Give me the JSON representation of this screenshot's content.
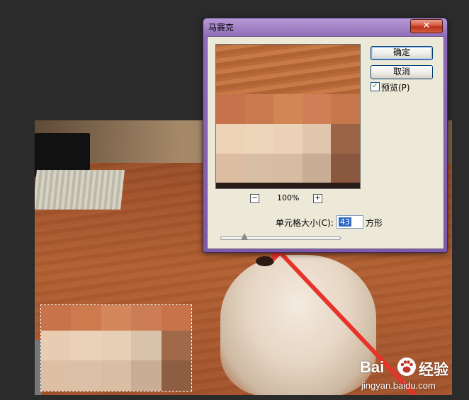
{
  "dialog": {
    "title": "马赛克",
    "close_label": "✕",
    "ok_label": "确定",
    "cancel_label": "取消",
    "preview_label": "预览(P)",
    "preview_checked": true,
    "zoom_out_label": "−",
    "zoom_in_label": "+",
    "zoom_value": "100%",
    "cell_size_label": "单元格大小(C):",
    "cell_size_value": "43",
    "cell_size_unit": "方形",
    "slider_fraction": 0.2
  },
  "watermark": {
    "brand": "Bai",
    "brand2": "经验",
    "url": "jingyan.baidu.com",
    "paw_icon": "baidu-paw-icon"
  },
  "colors": {
    "accent_purple": "#7d5aa8",
    "arrow_red": "#e8332a"
  },
  "mosaic_colors": [
    "#c9734a",
    "#cd7a4f",
    "#d4875a",
    "#cd7d55",
    "#c87349",
    "#e8cdb3",
    "#ead2b9",
    "#e7cfb5",
    "#d8c2aa",
    "#a06a4a",
    "#ddbfa4",
    "#dac1a7",
    "#d8bea3",
    "#c9ae96",
    "#8e5e42"
  ],
  "preview_colors": [
    "#c6724a",
    "#c97a4f",
    "#d28656",
    "#ce7f55",
    "#c6764b",
    "#edd2b6",
    "#edd5ba",
    "#ebd1b6",
    "#dfc6ad",
    "#9b6446",
    "#dcbda1",
    "#d7bda3",
    "#d6bca1",
    "#c9ad95",
    "#8a583e",
    "#2a1d18",
    "#2a1d18",
    "#2a1d18",
    "#2a1d18",
    "#2a1d18"
  ]
}
